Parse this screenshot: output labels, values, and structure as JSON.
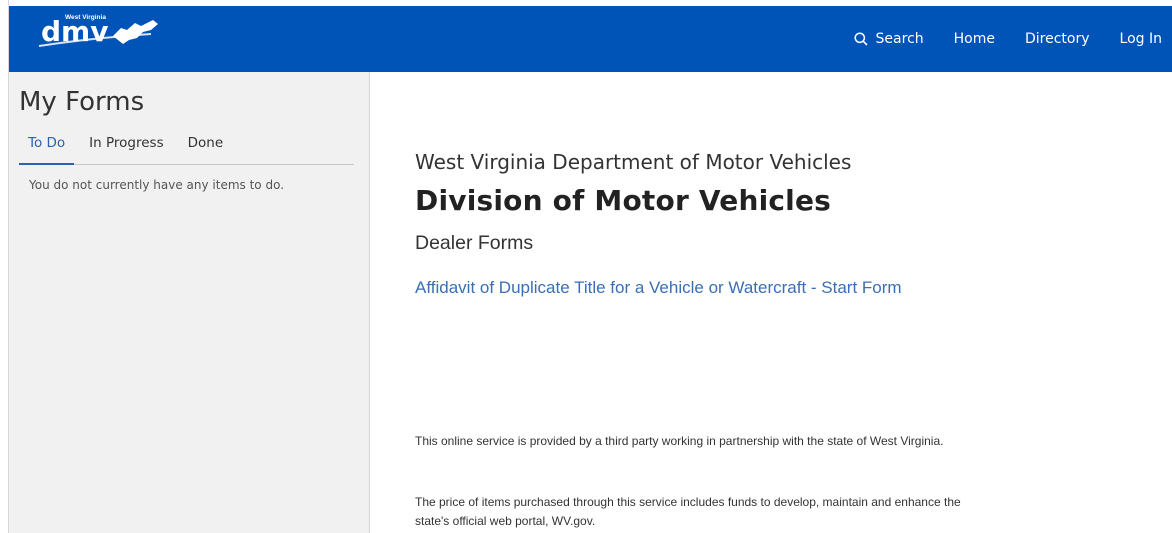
{
  "header": {
    "logo": {
      "small_text": "West Virginia",
      "main_text": "dmv"
    },
    "nav": [
      {
        "label": "Search",
        "icon": "search-icon"
      },
      {
        "label": "Home"
      },
      {
        "label": "Directory"
      },
      {
        "label": "Log In"
      }
    ],
    "colors": {
      "bar": "#0054b8",
      "text": "#ffffff"
    }
  },
  "sidebar": {
    "title": "My Forms",
    "tabs": [
      {
        "label": "To Do",
        "active": true
      },
      {
        "label": "In Progress",
        "active": false
      },
      {
        "label": "Done",
        "active": false
      }
    ],
    "empty_message": "You do not currently have any items to do."
  },
  "main": {
    "agency": "West Virginia Department of Motor Vehicles",
    "division": "Division of Motor Vehicles",
    "section": "Dealer Forms",
    "form_link": "Affidavit of Duplicate Title for a Vehicle or Watercraft - Start Form",
    "disclaimer": [
      "This online service is provided by a third party working in partnership with the state of West Virginia.",
      "The price of items purchased through this service includes funds to develop, maintain and enhance the state's official web portal, WV.gov."
    ],
    "colors": {
      "link": "#3a6eb5",
      "tab_active": "#2a62b0"
    }
  }
}
